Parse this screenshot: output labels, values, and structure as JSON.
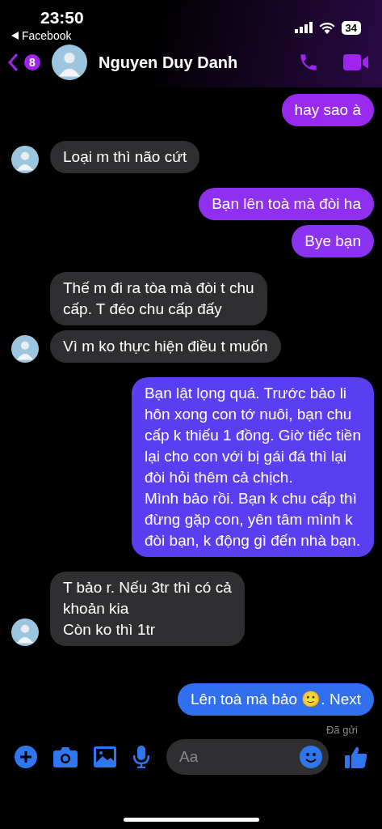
{
  "status_bar": {
    "time": "23:50",
    "back_app": "Facebook",
    "battery": "34"
  },
  "header": {
    "unread_count": "8",
    "name": "Nguyen Duy Danh"
  },
  "messages": [
    {
      "kind": "outgoing",
      "text": "hay sao à",
      "color": "#9a2af0"
    },
    {
      "kind": "incoming",
      "text": "Loại m thì não cứt",
      "color": "#2f2f31",
      "avatar": true
    },
    {
      "kind": "outgoing",
      "text": "Bạn lên toà mà đòi ha",
      "color": "#8f2ff0"
    },
    {
      "kind": "outgoing",
      "text": "Bye bạn",
      "color": "#8a33f0"
    },
    {
      "kind": "incoming",
      "text": "Thế m đi ra tòa mà đòi t chu\ncấp. T đéo chu cấp đấy",
      "color": "#2f2f31",
      "avatar": false
    },
    {
      "kind": "incoming",
      "text": "Vì m ko thực hiện điều t muốn",
      "color": "#2f2f31",
      "avatar": true
    },
    {
      "kind": "outgoing",
      "text": "Bạn lật lọng quá. Trước bảo li\nhôn xong con tớ nuôi, bạn chu\ncấp k thiếu 1 đồng. Giờ tiếc tiền\nlại cho con với bị gái đá thì lại\nđòi hỏi thêm cả chịch.\nMình bảo rồi. Bạn k chu cấp thì\nđừng gặp con, yên tâm mình k\nđòi bạn, k động gì đến nhà bạn.",
      "color": "#5a3ff2"
    },
    {
      "kind": "incoming",
      "text": "T bảo r. Nếu 3tr thì có cả\nkhoản kia\n Còn ko thì 1tr",
      "color": "#2f2f31",
      "avatar": true
    },
    {
      "kind": "outgoing",
      "text": "Lên toà mà bảo 🙂. Next",
      "color": "#2f6ff0"
    }
  ],
  "delivery_status": "Đã gửi",
  "composer": {
    "placeholder": "Aa"
  }
}
